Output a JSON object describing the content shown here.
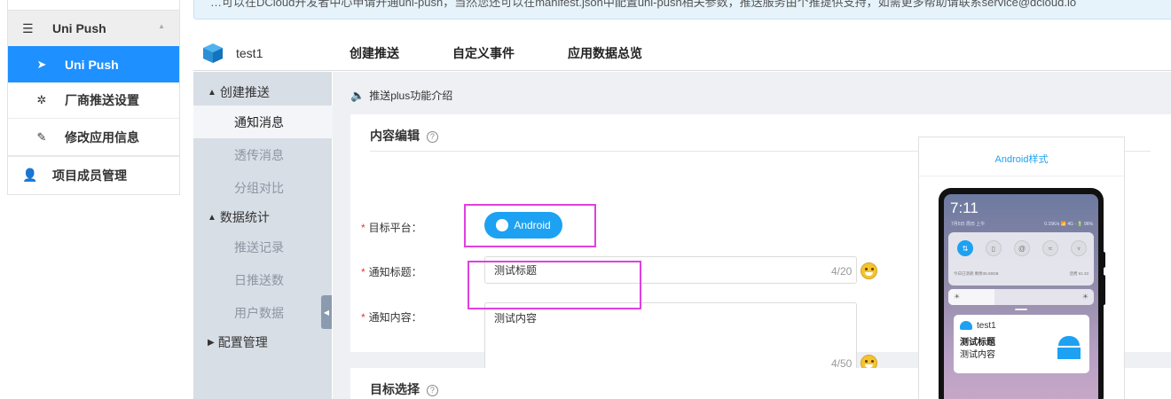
{
  "notice": {
    "text": "…可以在DCloud开发者中心申请开通uni-push，当然您还可以在manifest.json中配置uni-push相关参数，推送服务由个推提供支持，如需更多帮助请联系service@dcloud.io"
  },
  "left_nav": {
    "group_label": "Uni Push",
    "items": [
      {
        "label": "Uni Push",
        "icon": "paper-plane-icon",
        "active": true
      },
      {
        "label": "厂商推送设置",
        "icon": "gear-icon",
        "active": false
      },
      {
        "label": "修改应用信息",
        "icon": "edit-icon",
        "active": false
      }
    ],
    "member_label": "项目成员管理"
  },
  "app_header": {
    "app_name": "test1",
    "tabs": [
      "创建推送",
      "自定义事件",
      "应用数据总览"
    ]
  },
  "sub_nav": {
    "groups": [
      {
        "label": "创建推送",
        "expanded": true,
        "items": [
          "通知消息",
          "透传消息",
          "分组对比"
        ]
      },
      {
        "label": "数据统计",
        "expanded": true,
        "items": [
          "推送记录",
          "日推送数",
          "用户数据"
        ]
      },
      {
        "label": "配置管理",
        "expanded": false,
        "items": []
      }
    ],
    "active_item": "通知消息"
  },
  "main": {
    "intro_link": "推送plus功能介绍",
    "content_edit_title": "内容编辑",
    "target_select_title": "目标选择",
    "form": {
      "platform_label": "目标平台：",
      "platform_button": "Android",
      "title_label": "通知标题：",
      "title_value": "测试标题",
      "title_counter": "4/20",
      "content_label": "通知内容：",
      "content_value": "测试内容",
      "content_counter": "4/50"
    }
  },
  "preview": {
    "title": "Android样式",
    "time": "7:11",
    "date": "7月5日 周日 上午",
    "status": "0.15K/s 📶 4G · 🔋 96%",
    "info_left": "今日已消耗  剩余35.59GB",
    "info_right": "话费 ¥1.33",
    "notif_app": "test1",
    "notif_title": "测试标题",
    "notif_content": "测试内容"
  },
  "colors": {
    "accent": "#1e90ff",
    "highlight_box": "#e040e0",
    "subnav_bg": "#d8dee6"
  }
}
